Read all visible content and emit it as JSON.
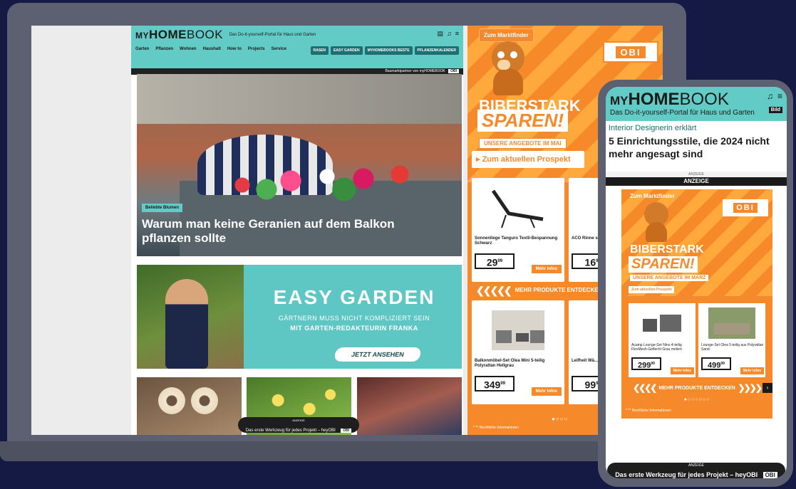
{
  "brand": {
    "logo_prefix": "MY",
    "logo_bold": "HOME",
    "logo_light": "BOOK",
    "tagline": "Das Do-it-yourself-Portal für Haus und Garten"
  },
  "desktop": {
    "nav": [
      "Garten",
      "Pflanzen",
      "Wohnen",
      "Haushalt",
      "How to",
      "Projects",
      "Service"
    ],
    "pills": [
      "RASEN",
      "EASY GARDEN",
      "MYHOMEBOOKS BESTE",
      "PFLANZENKALENDER"
    ],
    "partner_text": "Baumarktpartner von myHOMEBOOK",
    "partner_logo": "OBI",
    "hero": {
      "badge": "Beliebte Blumen",
      "title": "Warum man keine Geranien auf dem Balkon pflanzen sollte"
    },
    "easy_garden": {
      "title": "EASY GARDEN",
      "subtitle1": "GÄRTNERN MUSS NICHT KOMPLIZIERT SEIN",
      "subtitle2": "MIT GARTEN-REDAKTEURIN FRANKA",
      "button": "JETZT ANSEHEN"
    },
    "bottom_bar": {
      "small": "ANZEIGE",
      "text": "Das erste Werkzeug für jedes Projekt – heyOBI",
      "logo": "OBI"
    }
  },
  "ad": {
    "marktfinder": "Zum Marktfinder",
    "logo": "OBI",
    "headline1": "BIBERSTARK",
    "headline2": "SPAREN!",
    "offers": "UNSERE ANGEBOTE IM MAI",
    "prospekt": "Zum aktuellen Prospekt",
    "products": [
      {
        "name": "Sonnenliege Tanguro Textil-Bespannung Schwarz",
        "price": "29",
        "cents": "99",
        "more": "Mehr infos"
      },
      {
        "name": "ACO Rinne schwarzem ...",
        "price": "16",
        "cents": "9",
        "more": "Mehr infos"
      },
      {
        "name": "Balkonmöbel-Set Olea Mini 5-teilig Polyrattan Hellgrau",
        "price": "349",
        "cents": "99",
        "more": "Mehr infos"
      },
      {
        "name": "Leifheit Wä... 400 Easy",
        "price": "99",
        "cents": "9",
        "more": "Mehr infos"
      }
    ],
    "more_products": "MEHR PRODUKTE ENTDECKEN",
    "dots": "●○○○",
    "legal": "* ** Rechtliche Informationen"
  },
  "mobile": {
    "bild": "Bild",
    "kicker": "Interior Designerin erklärt",
    "headline": "5 Einrichtungsstile, die 2024 nicht mehr angesagt sind",
    "anzeige_small": "ANZEIGE",
    "anzeige_bar": "ANZEIGE",
    "ad": {
      "marktfinder": "Zum Marktfinder",
      "logo": "OBI",
      "headline1": "BIBERSTARK",
      "headline2": "SPAREN!",
      "offers": "UNSERE ANGEBOTE IM MÄRZ",
      "prospekt": "Zum aktuellen Prospekt",
      "products": [
        {
          "name": "Acamp Lounge-Set Nino 4-teilig FlexMesh-Geflecht Grau meliert",
          "price": "299",
          "cents": "99",
          "more": "Mehr infos"
        },
        {
          "name": "Lounge-Set Olea 5-teilig aus Polyrattan Sand",
          "price": "499",
          "cents": "99",
          "more": "Mehr infos"
        }
      ],
      "more_products": "MEHR PRODUKTE ENTDECKEN",
      "next": "›",
      "dots": "●○○○○○○",
      "legal": "* ** Rechtliche Informationen"
    },
    "bottom_bar": {
      "small": "ANZEIGE",
      "text": "Das erste Werkzeug für jedes Projekt – heyOBI",
      "logo": "OBI"
    }
  }
}
